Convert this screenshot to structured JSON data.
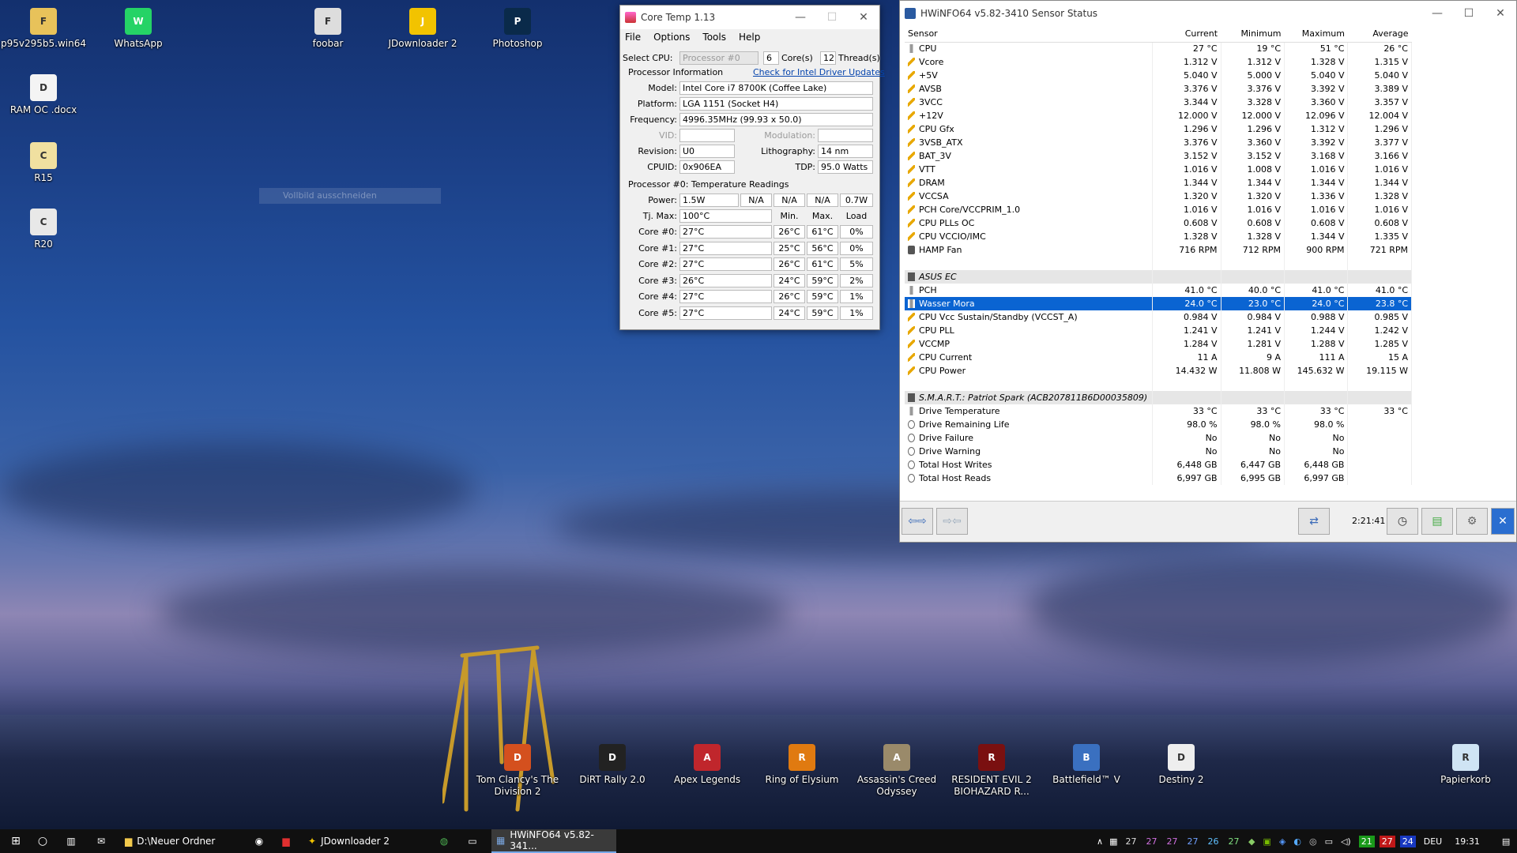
{
  "desktop": {
    "icons": [
      {
        "label": "p95v295b5.win64",
        "glyph": "folder-icon",
        "color": "#e8c25a"
      },
      {
        "label": "WhatsApp",
        "glyph": "whatsapp-icon",
        "color": "#25d366"
      },
      {
        "label": "foobar",
        "glyph": "foobar-icon",
        "color": "#dddddd"
      },
      {
        "label": "JDownloader 2",
        "glyph": "jdownloader-icon",
        "color": "#f2c300"
      },
      {
        "label": "Photoshop",
        "glyph": "photoshop-icon",
        "color": "#0a2a4a"
      },
      {
        "label": "RAM OC .docx",
        "glyph": "document-icon",
        "color": "#f4f4f4"
      },
      {
        "label": "R15",
        "glyph": "cinebench-icon",
        "color": "#f0e0a0"
      },
      {
        "label": "R20",
        "glyph": "cinebench-icon",
        "color": "#e8e8e8"
      },
      {
        "label": "Tom Clancy's The Division 2",
        "glyph": "division2-icon",
        "color": "#d4501e"
      },
      {
        "label": "DiRT Rally 2.0",
        "glyph": "dirt-icon",
        "color": "#222222"
      },
      {
        "label": "Apex Legends",
        "glyph": "apex-icon",
        "color": "#c0262c"
      },
      {
        "label": "Ring of Elysium",
        "glyph": "roe-icon",
        "color": "#e07a10"
      },
      {
        "label": "Assassin's Creed Odyssey",
        "glyph": "aco-icon",
        "color": "#9a8a6a"
      },
      {
        "label": "RESIDENT EVIL 2 BIOHAZARD R...",
        "glyph": "re2-icon",
        "color": "#7a1010"
      },
      {
        "label": "Battlefield™ V",
        "glyph": "bfv-icon",
        "color": "#3a70c0"
      },
      {
        "label": "Destiny 2",
        "glyph": "destiny-icon",
        "color": "#eeeeee"
      },
      {
        "label": "Papierkorb",
        "glyph": "recycle-bin-icon",
        "color": "#cfe4f4"
      }
    ],
    "ghost_label": "Vollbild ausschneiden"
  },
  "coretemp": {
    "title": "Core Temp 1.13",
    "menu": [
      "File",
      "Options",
      "Tools",
      "Help"
    ],
    "select_cpu_label": "Select CPU:",
    "select_cpu_value": "Processor #0",
    "cores_value": "6",
    "cores_label": "Core(s)",
    "threads_value": "12",
    "threads_label": "Thread(s)",
    "proc_info_label": "Processor Information",
    "driver_link": "Check for Intel Driver Updates",
    "model_label": "Model:",
    "model": "Intel Core i7 8700K (Coffee Lake)",
    "platform_label": "Platform:",
    "platform": "LGA 1151 (Socket H4)",
    "frequency_label": "Frequency:",
    "frequency": "4996.35MHz (99.93 x 50.0)",
    "vid_label": "VID:",
    "modulation_label": "Modulation:",
    "revision_label": "Revision:",
    "revision": "U0",
    "lithography_label": "Lithography:",
    "lithography": "14 nm",
    "cpuid_label": "CPUID:",
    "cpuid": "0x906EA",
    "tdp_label": "TDP:",
    "tdp": "95.0 Watts",
    "temp_heading": "Processor #0: Temperature Readings",
    "power_label": "Power:",
    "power": [
      "1.5W",
      "N/A",
      "N/A",
      "N/A",
      "0.7W"
    ],
    "tjmax_label": "Tj. Max:",
    "tjmax": "100°C",
    "col_min": "Min.",
    "col_max": "Max.",
    "col_load": "Load",
    "cores": [
      {
        "label": "Core #0:",
        "temp": "27°C",
        "min": "26°C",
        "max": "61°C",
        "load": "0%"
      },
      {
        "label": "Core #1:",
        "temp": "27°C",
        "min": "25°C",
        "max": "56°C",
        "load": "0%"
      },
      {
        "label": "Core #2:",
        "temp": "27°C",
        "min": "26°C",
        "max": "61°C",
        "load": "5%"
      },
      {
        "label": "Core #3:",
        "temp": "26°C",
        "min": "24°C",
        "max": "59°C",
        "load": "2%"
      },
      {
        "label": "Core #4:",
        "temp": "27°C",
        "min": "26°C",
        "max": "59°C",
        "load": "1%"
      },
      {
        "label": "Core #5:",
        "temp": "27°C",
        "min": "24°C",
        "max": "59°C",
        "load": "1%"
      }
    ]
  },
  "hwinfo": {
    "title": "HWiNFO64 v5.82-3410 Sensor Status",
    "headers": [
      "Sensor",
      "Current",
      "Minimum",
      "Maximum",
      "Average"
    ],
    "rows": [
      {
        "t": "s",
        "i": "t",
        "n": "CPU",
        "c": "27 °C",
        "mi": "19 °C",
        "ma": "51 °C",
        "a": "26 °C"
      },
      {
        "t": "s",
        "i": "v",
        "n": "Vcore",
        "c": "1.312 V",
        "mi": "1.312 V",
        "ma": "1.328 V",
        "a": "1.315 V"
      },
      {
        "t": "s",
        "i": "v",
        "n": "+5V",
        "c": "5.040 V",
        "mi": "5.000 V",
        "ma": "5.040 V",
        "a": "5.040 V"
      },
      {
        "t": "s",
        "i": "v",
        "n": "AVSB",
        "c": "3.376 V",
        "mi": "3.376 V",
        "ma": "3.392 V",
        "a": "3.389 V"
      },
      {
        "t": "s",
        "i": "v",
        "n": "3VCC",
        "c": "3.344 V",
        "mi": "3.328 V",
        "ma": "3.360 V",
        "a": "3.357 V"
      },
      {
        "t": "s",
        "i": "v",
        "n": "+12V",
        "c": "12.000 V",
        "mi": "12.000 V",
        "ma": "12.096 V",
        "a": "12.004 V"
      },
      {
        "t": "s",
        "i": "v",
        "n": "CPU Gfx",
        "c": "1.296 V",
        "mi": "1.296 V",
        "ma": "1.312 V",
        "a": "1.296 V"
      },
      {
        "t": "s",
        "i": "v",
        "n": "3VSB_ATX",
        "c": "3.376 V",
        "mi": "3.360 V",
        "ma": "3.392 V",
        "a": "3.377 V"
      },
      {
        "t": "s",
        "i": "v",
        "n": "BAT_3V",
        "c": "3.152 V",
        "mi": "3.152 V",
        "ma": "3.168 V",
        "a": "3.166 V"
      },
      {
        "t": "s",
        "i": "v",
        "n": "VTT",
        "c": "1.016 V",
        "mi": "1.008 V",
        "ma": "1.016 V",
        "a": "1.016 V"
      },
      {
        "t": "s",
        "i": "v",
        "n": "DRAM",
        "c": "1.344 V",
        "mi": "1.344 V",
        "ma": "1.344 V",
        "a": "1.344 V"
      },
      {
        "t": "s",
        "i": "v",
        "n": "VCCSA",
        "c": "1.320 V",
        "mi": "1.320 V",
        "ma": "1.336 V",
        "a": "1.328 V"
      },
      {
        "t": "s",
        "i": "v",
        "n": "PCH Core/VCCPRIM_1.0",
        "c": "1.016 V",
        "mi": "1.016 V",
        "ma": "1.016 V",
        "a": "1.016 V"
      },
      {
        "t": "s",
        "i": "v",
        "n": "CPU PLLs OC",
        "c": "0.608 V",
        "mi": "0.608 V",
        "ma": "0.608 V",
        "a": "0.608 V"
      },
      {
        "t": "s",
        "i": "v",
        "n": "CPU VCCIO/IMC",
        "c": "1.328 V",
        "mi": "1.328 V",
        "ma": "1.344 V",
        "a": "1.335 V"
      },
      {
        "t": "s",
        "i": "f",
        "n": "HAMP Fan",
        "c": "716 RPM",
        "mi": "712 RPM",
        "ma": "900 RPM",
        "a": "721 RPM"
      },
      {
        "t": "e",
        "n": "",
        "c": "",
        "mi": "",
        "ma": "",
        "a": ""
      },
      {
        "t": "g",
        "i": "g",
        "n": "ASUS EC",
        "c": "",
        "mi": "",
        "ma": "",
        "a": ""
      },
      {
        "t": "s",
        "i": "t",
        "n": "PCH",
        "c": "41.0 °C",
        "mi": "40.0 °C",
        "ma": "41.0 °C",
        "a": "41.0 °C"
      },
      {
        "t": "sel",
        "i": "t",
        "n": "Wasser Mora",
        "c": "24.0 °C",
        "mi": "23.0 °C",
        "ma": "24.0 °C",
        "a": "23.8 °C"
      },
      {
        "t": "s",
        "i": "v",
        "n": "CPU Vcc Sustain/Standby (VCCST_A)",
        "c": "0.984 V",
        "mi": "0.984 V",
        "ma": "0.988 V",
        "a": "0.985 V"
      },
      {
        "t": "s",
        "i": "v",
        "n": "CPU PLL",
        "c": "1.241 V",
        "mi": "1.241 V",
        "ma": "1.244 V",
        "a": "1.242 V"
      },
      {
        "t": "s",
        "i": "v",
        "n": "VCCMP",
        "c": "1.284 V",
        "mi": "1.281 V",
        "ma": "1.288 V",
        "a": "1.285 V"
      },
      {
        "t": "s",
        "i": "v",
        "n": "CPU Current",
        "c": "11 A",
        "mi": "9 A",
        "ma": "111 A",
        "a": "15 A"
      },
      {
        "t": "s",
        "i": "v",
        "n": "CPU Power",
        "c": "14.432 W",
        "mi": "11.808 W",
        "ma": "145.632 W",
        "a": "19.115 W"
      },
      {
        "t": "e",
        "n": "",
        "c": "",
        "mi": "",
        "ma": "",
        "a": ""
      },
      {
        "t": "g",
        "i": "g",
        "n": "S.M.A.R.T.: Patriot Spark (ACB207811B6D00035809)",
        "c": "",
        "mi": "",
        "ma": "",
        "a": ""
      },
      {
        "t": "s",
        "i": "t",
        "n": "Drive Temperature",
        "c": "33 °C",
        "mi": "33 °C",
        "ma": "33 °C",
        "a": "33 °C"
      },
      {
        "t": "s",
        "i": "c",
        "n": "Drive Remaining Life",
        "c": "98.0 %",
        "mi": "98.0 %",
        "ma": "98.0 %",
        "a": ""
      },
      {
        "t": "s",
        "i": "c",
        "n": "Drive Failure",
        "c": "No",
        "mi": "No",
        "ma": "No",
        "a": ""
      },
      {
        "t": "s",
        "i": "c",
        "n": "Drive Warning",
        "c": "No",
        "mi": "No",
        "ma": "No",
        "a": ""
      },
      {
        "t": "s",
        "i": "c",
        "n": "Total Host Writes",
        "c": "6,448 GB",
        "mi": "6,447 GB",
        "ma": "6,448 GB",
        "a": ""
      },
      {
        "t": "s",
        "i": "c",
        "n": "Total Host Reads",
        "c": "6,997 GB",
        "mi": "6,995 GB",
        "ma": "6,997 GB",
        "a": ""
      }
    ],
    "elapsed": "2:21:41"
  },
  "taskbar": {
    "explorer_label": "D:\\Neuer Ordner",
    "jdownloader_label": "JDownloader 2",
    "hwinfo_label": "HWiNFO64 v5.82-341...",
    "tray_temps": [
      "27",
      "27",
      "27",
      "27",
      "26",
      "27"
    ],
    "tray_colors": [
      "#dddddd",
      "#d070e0",
      "#d070e0",
      "#70a0ff",
      "#60c0ff",
      "#80e080"
    ],
    "badge_green": "21",
    "badge_red": "27",
    "badge_blue": "24",
    "lang": "DEU",
    "clock": "19:31"
  }
}
